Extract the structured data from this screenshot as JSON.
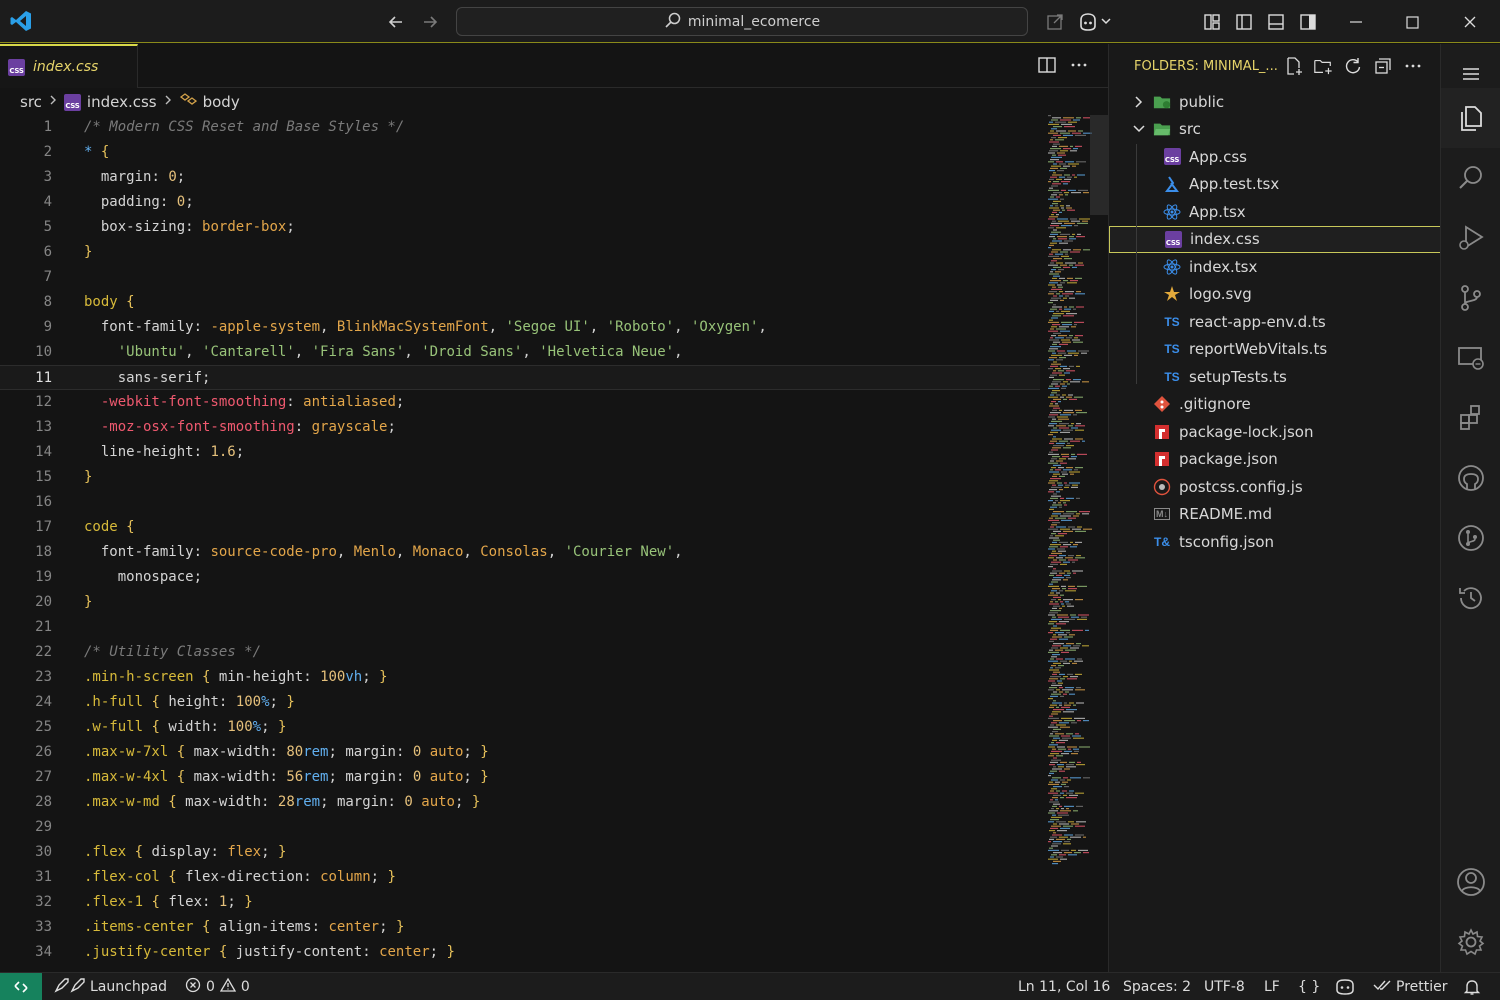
{
  "titlebar": {
    "search_text": "minimal_ecomerce"
  },
  "editor": {
    "tab_label": "index.css",
    "breadcrumb": [
      "src",
      "index.css",
      "body"
    ],
    "lines": [
      {
        "n": "1",
        "t": "/* Modern CSS Reset and Base Styles */"
      },
      {
        "n": "2",
        "t": "* {"
      },
      {
        "n": "3",
        "t": "  margin: 0;"
      },
      {
        "n": "4",
        "t": "  padding: 0;"
      },
      {
        "n": "5",
        "t": "  box-sizing: border-box;"
      },
      {
        "n": "6",
        "t": "}"
      },
      {
        "n": "7",
        "t": ""
      },
      {
        "n": "8",
        "t": "body {"
      },
      {
        "n": "9",
        "t": "  font-family: -apple-system, BlinkMacSystemFont, 'Segoe UI', 'Roboto', 'Oxygen',"
      },
      {
        "n": "10",
        "t": "    'Ubuntu', 'Cantarell', 'Fira Sans', 'Droid Sans', 'Helvetica Neue',"
      },
      {
        "n": "11",
        "t": "    sans-serif;"
      },
      {
        "n": "12",
        "t": "  -webkit-font-smoothing: antialiased;"
      },
      {
        "n": "13",
        "t": "  -moz-osx-font-smoothing: grayscale;"
      },
      {
        "n": "14",
        "t": "  line-height: 1.6;"
      },
      {
        "n": "15",
        "t": "}"
      },
      {
        "n": "16",
        "t": ""
      },
      {
        "n": "17",
        "t": "code {"
      },
      {
        "n": "18",
        "t": "  font-family: source-code-pro, Menlo, Monaco, Consolas, 'Courier New',"
      },
      {
        "n": "19",
        "t": "    monospace;"
      },
      {
        "n": "20",
        "t": "}"
      },
      {
        "n": "21",
        "t": ""
      },
      {
        "n": "22",
        "t": "/* Utility Classes */"
      },
      {
        "n": "23",
        "t": ".min-h-screen { min-height: 100vh; }"
      },
      {
        "n": "24",
        "t": ".h-full { height: 100%; }"
      },
      {
        "n": "25",
        "t": ".w-full { width: 100%; }"
      },
      {
        "n": "26",
        "t": ".max-w-7xl { max-width: 80rem; margin: 0 auto; }"
      },
      {
        "n": "27",
        "t": ".max-w-4xl { max-width: 56rem; margin: 0 auto; }"
      },
      {
        "n": "28",
        "t": ".max-w-md { max-width: 28rem; margin: 0 auto; }"
      },
      {
        "n": "29",
        "t": ""
      },
      {
        "n": "30",
        "t": ".flex { display: flex; }"
      },
      {
        "n": "31",
        "t": ".flex-col { flex-direction: column; }"
      },
      {
        "n": "32",
        "t": ".flex-1 { flex: 1; }"
      },
      {
        "n": "33",
        "t": ".items-center { align-items: center; }"
      },
      {
        "n": "34",
        "t": ".justify-center { justify-content: center; }"
      }
    ],
    "current_line": "11"
  },
  "explorer": {
    "header": "FOLDERS: MINIMAL_...",
    "items": [
      {
        "label": "public",
        "icon": "folder-public-icon",
        "kind": "folder-closed",
        "level": 0
      },
      {
        "label": "src",
        "icon": "folder-src-icon",
        "kind": "folder-open",
        "level": 0
      },
      {
        "label": "App.css",
        "icon": "css-file-icon",
        "kind": "css",
        "level": 1
      },
      {
        "label": "App.test.tsx",
        "icon": "test-file-icon",
        "kind": "test",
        "level": 1
      },
      {
        "label": "App.tsx",
        "icon": "react-file-icon",
        "kind": "react",
        "level": 1
      },
      {
        "label": "index.css",
        "icon": "css-file-icon",
        "kind": "css",
        "level": 1,
        "selected": true
      },
      {
        "label": "index.tsx",
        "icon": "react-file-icon",
        "kind": "react",
        "level": 1
      },
      {
        "label": "logo.svg",
        "icon": "svg-file-icon",
        "kind": "svg",
        "level": 1
      },
      {
        "label": "react-app-env.d.ts",
        "icon": "ts-file-icon",
        "kind": "ts",
        "level": 1
      },
      {
        "label": "reportWebVitals.ts",
        "icon": "ts-file-icon",
        "kind": "ts",
        "level": 1
      },
      {
        "label": "setupTests.ts",
        "icon": "ts-file-icon",
        "kind": "ts",
        "level": 1
      },
      {
        "label": ".gitignore",
        "icon": "git-file-icon",
        "kind": "git",
        "level": 0
      },
      {
        "label": "package-lock.json",
        "icon": "npm-file-icon",
        "kind": "npm",
        "level": 0
      },
      {
        "label": "package.json",
        "icon": "npm-file-icon",
        "kind": "npm",
        "level": 0
      },
      {
        "label": "postcss.config.js",
        "icon": "postcss-file-icon",
        "kind": "postcss",
        "level": 0
      },
      {
        "label": "README.md",
        "icon": "markdown-file-icon",
        "kind": "md",
        "level": 0
      },
      {
        "label": "tsconfig.json",
        "icon": "tsconfig-file-icon",
        "kind": "tsconfig",
        "level": 0
      }
    ]
  },
  "statusbar": {
    "launchpad": "Launchpad",
    "errors": "0",
    "warnings": "0",
    "position": "Ln 11, Col 16",
    "spaces": "Spaces: 2",
    "encoding": "UTF-8",
    "eol": "LF",
    "language": "{ }",
    "prettier": "Prettier"
  },
  "colors": {
    "accent_yellow": "#e6d46a",
    "remote_green": "#16825d",
    "css_purple": "#6b3fa0",
    "ts_blue": "#3b8eea"
  }
}
